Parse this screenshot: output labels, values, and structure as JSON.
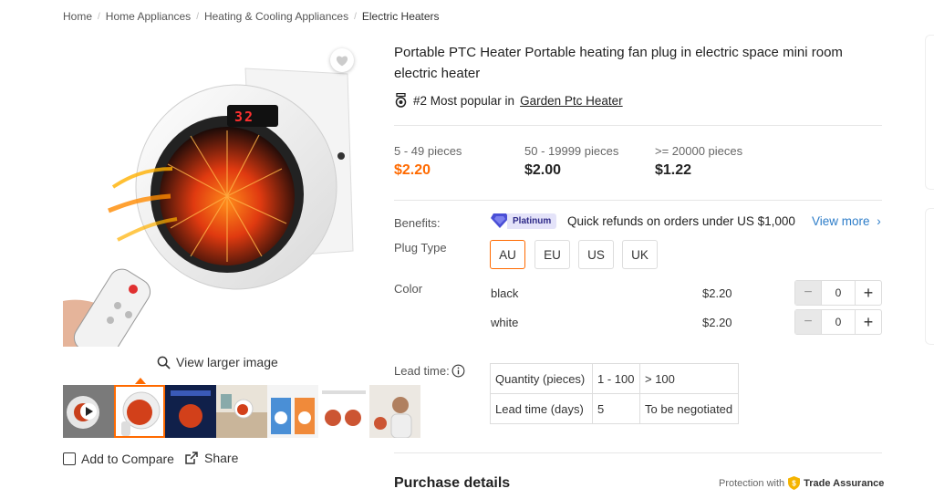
{
  "breadcrumb": [
    "Home",
    "Home Appliances",
    "Heating & Cooling Appliances",
    "Electric Heaters"
  ],
  "gallery": {
    "view_larger": "View larger image",
    "heater_display": "32",
    "add_to_compare": "Add to Compare",
    "share": "Share"
  },
  "product": {
    "title": "Portable PTC Heater Portable heating fan plug in electric space mini room electric heater",
    "popular_prefix": "#2 Most popular in",
    "popular_link": "Garden Ptc Heater"
  },
  "price_tiers": [
    {
      "range": "5 - 49 pieces",
      "price": "$2.20"
    },
    {
      "range": "50 - 19999 pieces",
      "price": "$2.00"
    },
    {
      "range": ">= 20000 pieces",
      "price": "$1.22"
    }
  ],
  "benefits": {
    "label": "Benefits:",
    "badge": "Platinum",
    "text": "Quick refunds on orders under US $1,000",
    "view_more": "View more"
  },
  "plug_type": {
    "label": "Plug Type",
    "options": [
      "AU",
      "EU",
      "US",
      "UK"
    ],
    "selected": "AU"
  },
  "color": {
    "label": "Color",
    "options": [
      {
        "name": "black",
        "price": "$2.20",
        "qty": "0"
      },
      {
        "name": "white",
        "price": "$2.20",
        "qty": "0"
      }
    ]
  },
  "lead_time": {
    "label": "Lead time:",
    "rows": [
      [
        "Quantity (pieces)",
        "1 - 100",
        "> 100"
      ],
      [
        "Lead time (days)",
        "5",
        "To be negotiated"
      ]
    ]
  },
  "purchase": {
    "title": "Purchase details",
    "protection_prefix": "Protection with",
    "trade_assurance": "Trade Assurance"
  },
  "colors": {
    "accent": "#ff6a00",
    "link": "#2d7dc9",
    "platinum": "#4a4fd6"
  }
}
